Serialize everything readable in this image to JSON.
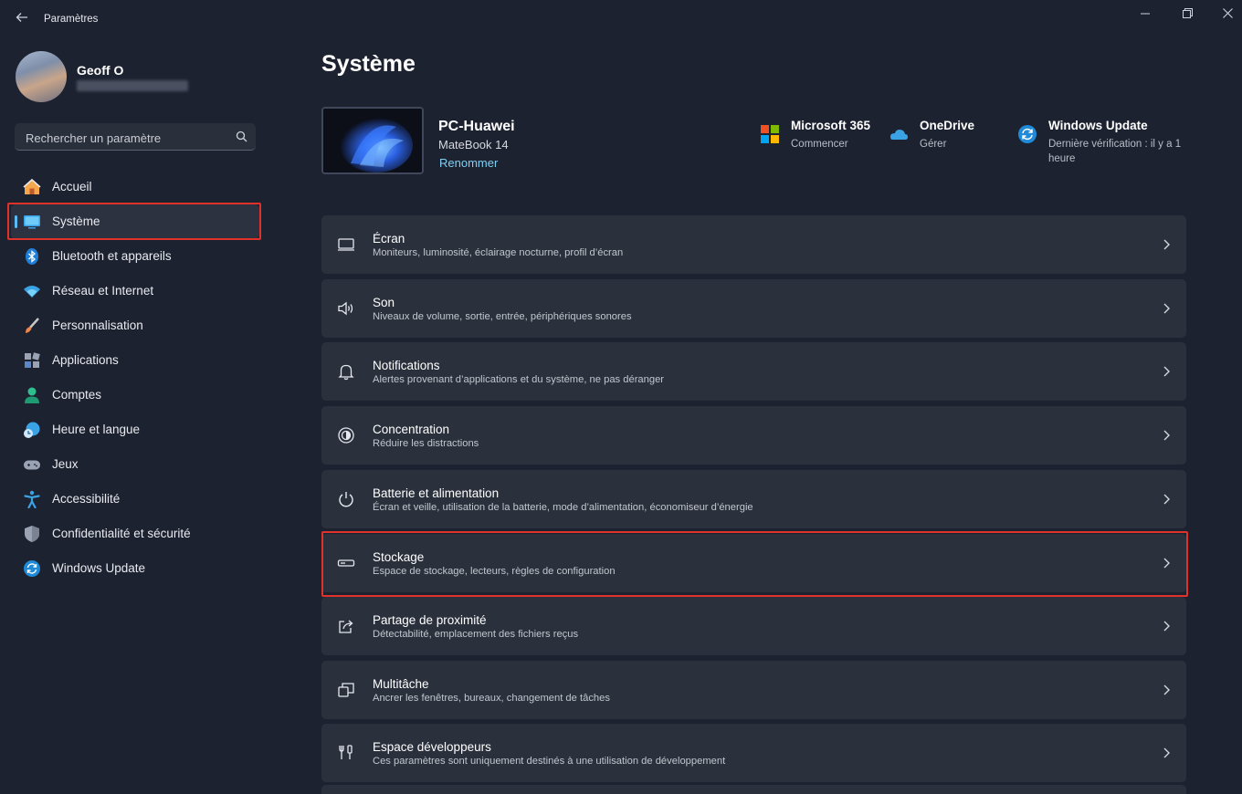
{
  "app": {
    "title": "Paramètres",
    "back_icon": "arrow-left-icon"
  },
  "window_controls": [
    "minimize-icon",
    "maximize-icon",
    "close-icon"
  ],
  "user": {
    "name": "Geoff O"
  },
  "search": {
    "placeholder": "Rechercher un paramètre",
    "icon": "search-icon"
  },
  "sidebar": {
    "items": [
      {
        "label": "Accueil",
        "icon": "home-icon"
      },
      {
        "label": "Système",
        "icon": "display-icon",
        "active": true
      },
      {
        "label": "Bluetooth et appareils",
        "icon": "bluetooth-icon"
      },
      {
        "label": "Réseau et Internet",
        "icon": "wifi-icon"
      },
      {
        "label": "Personnalisation",
        "icon": "brush-icon"
      },
      {
        "label": "Applications",
        "icon": "apps-icon"
      },
      {
        "label": "Comptes",
        "icon": "account-icon"
      },
      {
        "label": "Heure et langue",
        "icon": "clock-globe-icon"
      },
      {
        "label": "Jeux",
        "icon": "gamepad-icon"
      },
      {
        "label": "Accessibilité",
        "icon": "accessibility-icon"
      },
      {
        "label": "Confidentialité et sécurité",
        "icon": "shield-icon"
      },
      {
        "label": "Windows Update",
        "icon": "update-icon"
      }
    ]
  },
  "main": {
    "title": "Système",
    "device": {
      "name": "PC-Huawei",
      "model": "MateBook 14",
      "rename": "Renommer"
    },
    "quick_links": [
      {
        "title": "Microsoft 365",
        "subtitle": "Commencer",
        "icon": "microsoft-logo-icon"
      },
      {
        "title": "OneDrive",
        "subtitle": "Gérer",
        "icon": "cloud-icon"
      },
      {
        "title": "Windows Update",
        "subtitle": "Dernière vérification : il y a 1 heure",
        "icon": "sync-icon"
      }
    ],
    "cards": [
      {
        "title": "Écran",
        "subtitle": "Moniteurs, luminosité, éclairage nocturne, profil d’écran",
        "icon": "monitor-icon"
      },
      {
        "title": "Son",
        "subtitle": "Niveaux de volume, sortie, entrée, périphériques sonores",
        "icon": "speaker-icon"
      },
      {
        "title": "Notifications",
        "subtitle": "Alertes provenant d’applications et du système, ne pas déranger",
        "icon": "bell-icon"
      },
      {
        "title": "Concentration",
        "subtitle": "Réduire les distractions",
        "icon": "focus-icon"
      },
      {
        "title": "Batterie et alimentation",
        "subtitle": "Écran et veille, utilisation de la batterie, mode d’alimentation, économiseur d’énergie",
        "icon": "power-icon"
      },
      {
        "title": "Stockage",
        "subtitle": "Espace de stockage, lecteurs, règles de configuration",
        "icon": "storage-icon"
      },
      {
        "title": "Partage de proximité",
        "subtitle": "Détectabilité, emplacement des fichiers reçus",
        "icon": "share-icon"
      },
      {
        "title": "Multitâche",
        "subtitle": "Ancrer les fenêtres, bureaux, changement de tâches",
        "icon": "multitask-icon"
      },
      {
        "title": "Espace développeurs",
        "subtitle": "Ces paramètres sont uniquement destinés à une utilisation de développement",
        "icon": "developer-tools-icon"
      }
    ],
    "chevron_icon": "chevron-right-icon"
  },
  "colors": {
    "background": "#1d2230",
    "card": "#2a303c",
    "accent": "#5bbcf5",
    "highlight": "#e0312a"
  }
}
